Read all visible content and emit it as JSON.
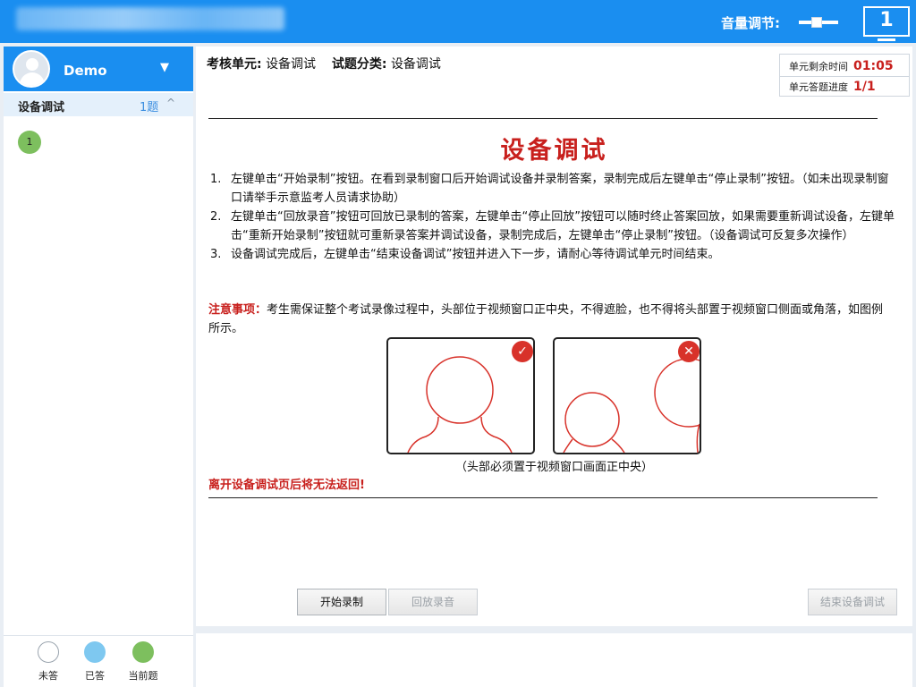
{
  "topbar": {
    "volume_label": "音量调节:",
    "monitor_number": "1"
  },
  "sidebar": {
    "user_name": "Demo",
    "group": {
      "name": "设备调试",
      "count": "1题"
    },
    "questions": [
      {
        "number": "1",
        "status": "current"
      }
    ],
    "legend": [
      {
        "label": "未答",
        "color": "#ffffff"
      },
      {
        "label": "已答",
        "color": "#7ec8f0"
      },
      {
        "label": "当前题",
        "color": "#7dbf5e"
      }
    ]
  },
  "header": {
    "unit_label": "考核单元:",
    "unit_value": "设备调试",
    "category_label": "试题分类:",
    "category_value": "设备调试"
  },
  "timer": {
    "remaining_label": "单元剩余时间",
    "remaining_value": "01:05",
    "progress_label": "单元答题进度",
    "progress_value": "1/1"
  },
  "content": {
    "title": "设备调试",
    "steps": [
      {
        "num": "1.",
        "text": "左键单击“开始录制”按钮。在看到录制窗口后开始调试设备并录制答案，录制完成后左键单击“停止录制”按钮。（如未出现录制窗口请举手示意监考人员请求协助）"
      },
      {
        "num": "2.",
        "text": "左键单击“回放录音”按钮可回放已录制的答案，左键单击“停止回放”按钮可以随时终止答案回放，如果需要重新调试设备，左键单击“重新开始录制”按钮就可重新录答案并调试设备，录制完成后，左键单击“停止录制”按钮。（设备调试可反复多次操作）"
      },
      {
        "num": "3.",
        "text": "设备调试完成后，左键单击“结束设备调试”按钮并进入下一步，请耐心等待调试单元时间结束。"
      }
    ],
    "notice_label": "注意事项：",
    "notice_text": "考生需保证整个考试录像过程中，头部位于视频窗口正中央，不得遮脸，也不得将头部置于视频窗口侧面或角落，如图例所示。",
    "image_caption": "（头部必须置于视频窗口画面正中央）",
    "warning": "离开设备调试页后将无法返回!"
  },
  "buttons": {
    "start_record": "开始录制",
    "playback": "回放录音",
    "finish": "结束设备调试"
  },
  "colors": {
    "accent": "#1a8ef0",
    "alert_red": "#c8201d",
    "current_green": "#7dbf5e"
  }
}
